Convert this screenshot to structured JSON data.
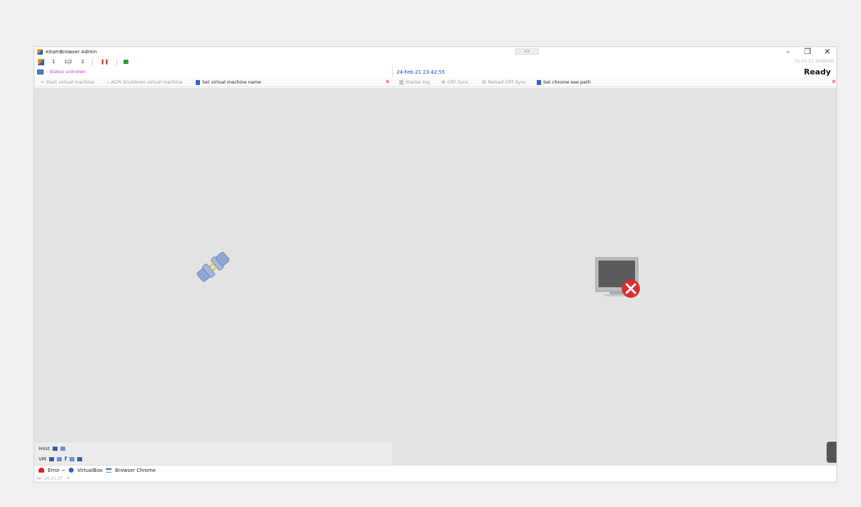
{
  "window": {
    "title": "eXamBrowser Admin",
    "center_control": "  XX ",
    "build_info": "05.03.21 3048000"
  },
  "window_controls": {
    "minimize": "–",
    "restore": "❐",
    "close": "✕"
  },
  "toolbar": {
    "items": [
      "1",
      "1|2",
      "2"
    ]
  },
  "status": {
    "unknown_label": "- Status unknown",
    "timestamp": "24-Feb-21 23:42:55",
    "ready": "Ready"
  },
  "actions_left": {
    "start_vm": "Start virtual machine",
    "acpi_shutdown": "ACPI Shutdown virtual machine",
    "set_vm_name": "Set virtual machine name"
  },
  "actions_right": {
    "starter_log": "Starter log",
    "crt_sync": "CRT Sync",
    "reload_crt_sync": "Reload CRT Sync",
    "set_chrome_path": "Set chrome exe path"
  },
  "bottom_panel": {
    "host_label": "Host",
    "vm_label": "VM"
  },
  "taskbar": {
    "error_label": "Error ~",
    "virtualbox_label": "VirtualBox",
    "chrome_label": "Browser Chrome"
  },
  "footer": {
    "version_text": "Ver 24.21.37 - 0"
  },
  "colors": {
    "status_unknown": "#d22fd2",
    "timestamp": "#2040c0",
    "error": "#d22222",
    "accent": "#2a64c4"
  }
}
